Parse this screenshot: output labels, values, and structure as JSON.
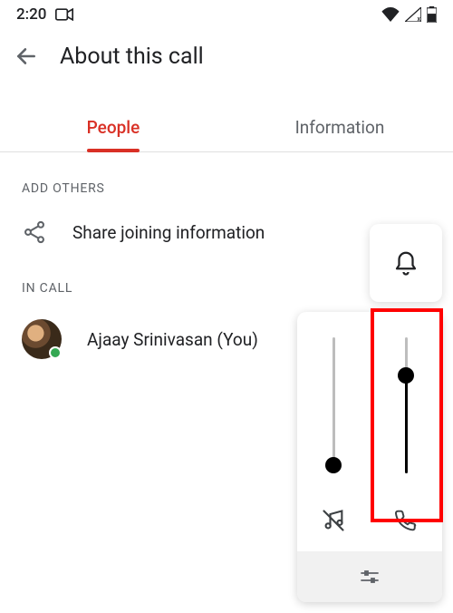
{
  "status": {
    "time": "2:20"
  },
  "header": {
    "title": "About this call"
  },
  "tabs": {
    "people": "People",
    "information": "Information",
    "active": "people"
  },
  "sections": {
    "add_others_label": "ADD OTHERS",
    "share_label": "Share joining information",
    "in_call_label": "IN CALL"
  },
  "participants": [
    {
      "name": "Ajaay Srinivasan (You)",
      "presence": "online"
    }
  ],
  "volume": {
    "media": {
      "level_pct": 6
    },
    "call": {
      "level_pct": 72
    }
  }
}
